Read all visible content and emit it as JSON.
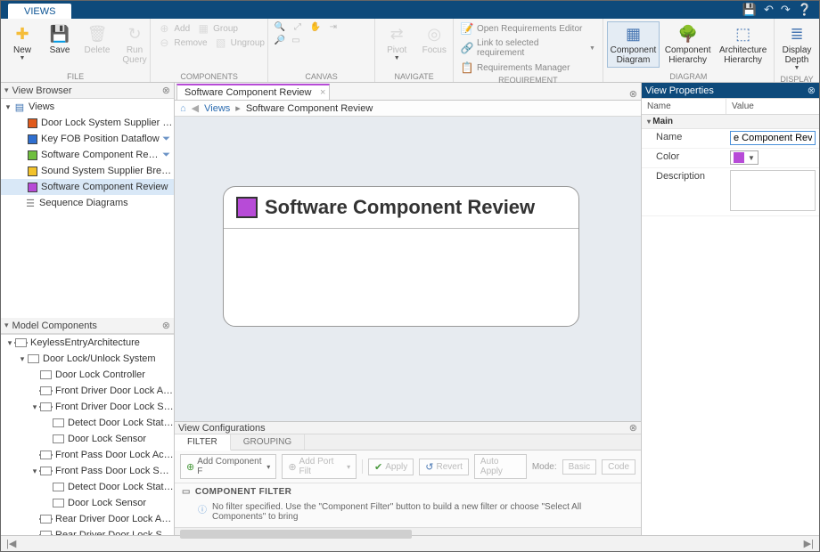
{
  "title_tab": "VIEWS",
  "ribbon": {
    "file": {
      "label": "FILE",
      "new": "New",
      "save": "Save",
      "delete": "Delete",
      "run_query": "Run\nQuery"
    },
    "components": {
      "label": "COMPONENTS",
      "add": "Add",
      "remove": "Remove",
      "group": "Group",
      "ungroup": "Ungroup"
    },
    "canvas": {
      "label": "CANVAS",
      "pivot": "Pivot",
      "focus": "Focus"
    },
    "navigate": {
      "label": "NAVIGATE"
    },
    "requirement": {
      "label": "REQUIREMENT",
      "open_editor": "Open Requirements Editor",
      "link_selected": "Link to selected requirement",
      "manager": "Requirements Manager"
    },
    "diagram": {
      "label": "DIAGRAM",
      "component_diagram": "Component\nDiagram",
      "component_hierarchy": "Component\nHierarchy",
      "architecture_hierarchy": "Architecture\nHierarchy"
    },
    "display": {
      "label": "DISPLAY",
      "depth": "Display\nDepth"
    }
  },
  "view_browser": {
    "title": "View Browser",
    "root": "Views",
    "items": [
      {
        "label": "Door Lock System Supplier Br...",
        "color": "#e05a1c",
        "filter": false
      },
      {
        "label": "Key FOB Position Dataflow",
        "color": "#2f6fd0",
        "filter": true
      },
      {
        "label": "Software Component Revi...",
        "color": "#6fbf3e",
        "filter": true
      },
      {
        "label": "Sound System Supplier Break...",
        "color": "#f2c22b",
        "filter": false
      },
      {
        "label": "Software Component Review",
        "color": "#b74bd7",
        "filter": false,
        "selected": true
      }
    ],
    "seq": "Sequence Diagrams"
  },
  "model_components": {
    "title": "Model Components",
    "tree": [
      {
        "d": 0,
        "ex": true,
        "label": "KeylessEntryArchitecture",
        "ports": true
      },
      {
        "d": 1,
        "ex": true,
        "label": "Door Lock/Unlock System"
      },
      {
        "d": 2,
        "ex": false,
        "label": "Door Lock Controller"
      },
      {
        "d": 2,
        "ex": false,
        "label": "Front Driver Door Lock Actuator",
        "ports": true
      },
      {
        "d": 2,
        "ex": true,
        "label": "Front Driver Door Lock Sensor",
        "ports": true
      },
      {
        "d": 3,
        "ex": false,
        "label": "Detect Door Lock Status"
      },
      {
        "d": 3,
        "ex": false,
        "label": "Door Lock Sensor"
      },
      {
        "d": 2,
        "ex": false,
        "label": "Front Pass Door Lock Actuator",
        "ports": true
      },
      {
        "d": 2,
        "ex": true,
        "label": "Front Pass Door Lock Sensor",
        "ports": true
      },
      {
        "d": 3,
        "ex": false,
        "label": "Detect Door Lock Status"
      },
      {
        "d": 3,
        "ex": false,
        "label": "Door Lock Sensor"
      },
      {
        "d": 2,
        "ex": false,
        "label": "Rear Driver Door Lock Actuator",
        "ports": true
      },
      {
        "d": 2,
        "ex": true,
        "label": "Rear Driver Door Lock Sensor",
        "ports": true
      }
    ]
  },
  "document": {
    "tab": "Software Component Review",
    "crumb_root": "Views",
    "crumb_leaf": "Software Component Review",
    "box_title": "Software Component Review",
    "box_color": "#b74bd7"
  },
  "view_config": {
    "title": "View Configurations",
    "tabs": {
      "filter": "FILTER",
      "grouping": "GROUPING"
    },
    "toolbar": {
      "add_comp": "Add Component F",
      "add_port": "Add Port Filt",
      "apply": "Apply",
      "revert": "Revert",
      "auto": "Auto Apply",
      "mode": "Mode:",
      "basic": "Basic",
      "code": "Code"
    },
    "section": "COMPONENT FILTER",
    "msg": "No filter specified. Use the \"Component Filter\" button to build a new filter or choose \"Select All Components\" to bring"
  },
  "properties": {
    "title": "View Properties",
    "name_col": "Name",
    "value_col": "Value",
    "cat": "Main",
    "name_label": "Name",
    "name_value": "e Component Review",
    "color_label": "Color",
    "color_value": "#b74bd7",
    "desc_label": "Description"
  }
}
